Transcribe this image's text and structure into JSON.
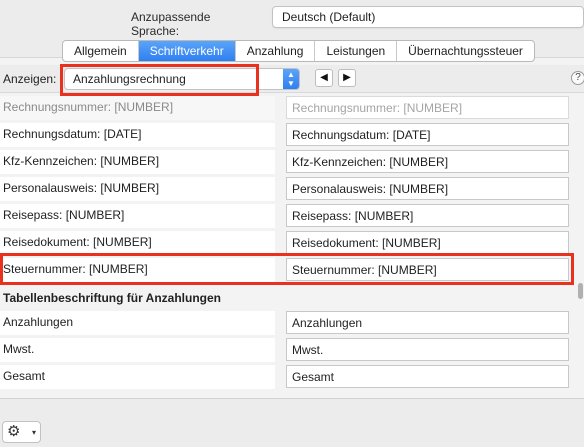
{
  "language": {
    "label": "Anzupassende Sprache:",
    "value": "Deutsch (Default)"
  },
  "tabs": [
    {
      "label": "Allgemein",
      "active": false
    },
    {
      "label": "Schriftverkehr",
      "active": true
    },
    {
      "label": "Anzahlung",
      "active": false
    },
    {
      "label": "Leistungen",
      "active": false
    },
    {
      "label": "Übernachtungssteuer",
      "active": false
    }
  ],
  "show": {
    "label": "Anzeigen:",
    "value": "Anzahlungsrechnung",
    "prev_icon": "◀",
    "next_icon": "▶"
  },
  "help_icon": "?",
  "rows": [
    {
      "label": "Rechnungsnummer: [NUMBER]",
      "value": "Rechnungsnummer: [NUMBER]"
    },
    {
      "label": "Rechnungsdatum: [DATE]",
      "value": "Rechnungsdatum: [DATE]"
    },
    {
      "label": "Kfz-Kennzeichen: [NUMBER]",
      "value": "Kfz-Kennzeichen: [NUMBER]"
    },
    {
      "label": "Personalausweis: [NUMBER]",
      "value": "Personalausweis: [NUMBER]"
    },
    {
      "label": "Reisepass: [NUMBER]",
      "value": "Reisepass: [NUMBER]"
    },
    {
      "label": "Reisedokument: [NUMBER]",
      "value": "Reisedokument: [NUMBER]"
    },
    {
      "label": "Steuernummer: [NUMBER]",
      "value": "Steuernummer: [NUMBER]"
    }
  ],
  "section": {
    "title": "Tabellenbeschriftung für Anzahlungen"
  },
  "table_rows": [
    {
      "label": "Anzahlungen",
      "value": "Anzahlungen"
    },
    {
      "label": "Mwst.",
      "value": "Mwst."
    },
    {
      "label": "Gesamt",
      "value": "Gesamt"
    }
  ],
  "gear": {
    "icon": "⚙",
    "caret": "▾"
  },
  "colors": {
    "accent": "#2f7ff2",
    "highlight": "#e8321e"
  }
}
